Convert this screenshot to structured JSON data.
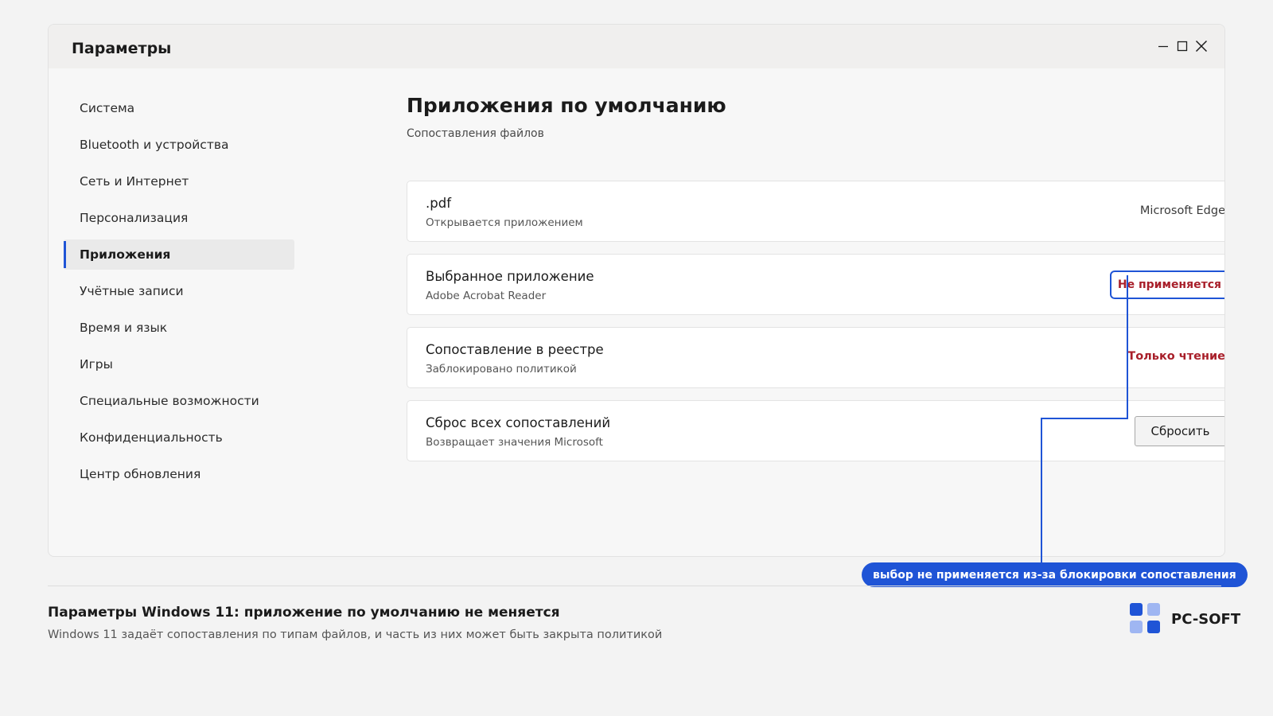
{
  "window": {
    "title": "Параметры",
    "controls": {
      "minimize": "minimize-icon",
      "maximize": "maximize-icon",
      "close": "close-icon"
    }
  },
  "sidebar": {
    "items": [
      {
        "label": "Система",
        "active": false
      },
      {
        "label": "Bluetooth и устройства",
        "active": false
      },
      {
        "label": "Сеть и Интернет",
        "active": false
      },
      {
        "label": "Персонализация",
        "active": false
      },
      {
        "label": "Приложения",
        "active": true
      },
      {
        "label": "Учётные записи",
        "active": false
      },
      {
        "label": "Время и язык",
        "active": false
      },
      {
        "label": "Игры",
        "active": false
      },
      {
        "label": "Специальные возможности",
        "active": false
      },
      {
        "label": "Конфиденциальность",
        "active": false
      },
      {
        "label": "Центр обновления",
        "active": false
      }
    ]
  },
  "main": {
    "title": "Приложения по умолчанию",
    "section_label": "Сопоставления файлов",
    "cards": [
      {
        "title": ".pdf",
        "subtitle": "Открывается приложением",
        "value": "Microsoft Edge"
      },
      {
        "title": "Выбранное приложение",
        "subtitle": "Adobe Acrobat Reader",
        "status": "Не применяется"
      },
      {
        "title": "Сопоставление в реестре",
        "subtitle": "Заблокировано политикой",
        "status": "Только чтение"
      },
      {
        "title": "Сброс всех сопоставлений",
        "subtitle": "Возвращает значения Microsoft",
        "button": "Сбросить"
      }
    ]
  },
  "annotation": {
    "text": "выбор не применяется из-за блокировки сопоставления"
  },
  "caption": {
    "title": "Параметры Windows 11: приложение по умолчанию не меняется",
    "subtitle": "Windows 11 задаёт сопоставления по типам файлов, и часть из них может быть закрыта политикой"
  },
  "brand": {
    "name": "PC-SOFT"
  },
  "colors": {
    "accent": "#1f54d6",
    "warning": "#a81f2a",
    "logo_light": "#9fb6f2"
  }
}
